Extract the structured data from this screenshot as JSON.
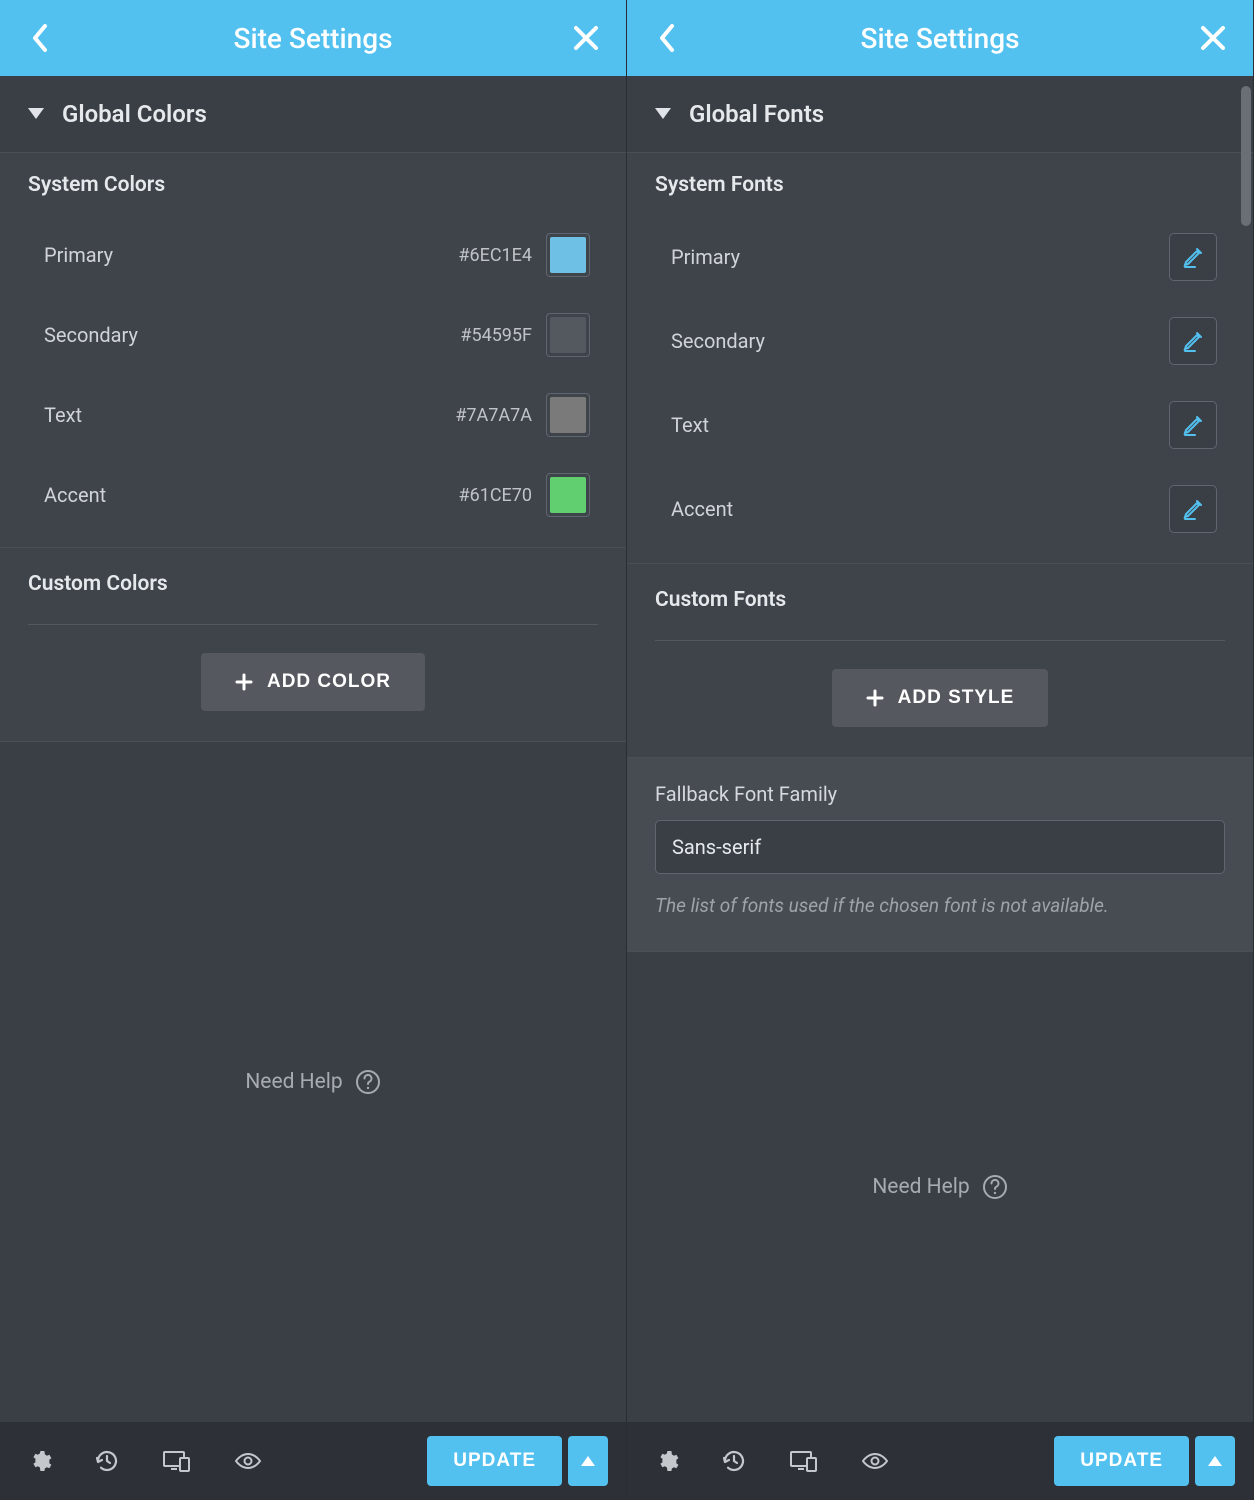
{
  "left": {
    "header": {
      "title": "Site Settings"
    },
    "section_title": "Global Colors",
    "system_title": "System Colors",
    "colors": [
      {
        "label": "Primary",
        "hex": "#6EC1E4",
        "value": "#6EC1E4"
      },
      {
        "label": "Secondary",
        "hex": "#54595F",
        "value": "#54595F"
      },
      {
        "label": "Text",
        "hex": "#7A7A7A",
        "value": "#7A7A7A"
      },
      {
        "label": "Accent",
        "hex": "#61CE70",
        "value": "#61CE70"
      }
    ],
    "custom_title": "Custom Colors",
    "add_label": "ADD COLOR",
    "need_help": "Need Help",
    "update_label": "UPDATE"
  },
  "right": {
    "header": {
      "title": "Site Settings"
    },
    "section_title": "Global Fonts",
    "system_title": "System Fonts",
    "fonts": [
      {
        "label": "Primary"
      },
      {
        "label": "Secondary"
      },
      {
        "label": "Text"
      },
      {
        "label": "Accent"
      }
    ],
    "custom_title": "Custom Fonts",
    "add_label": "ADD STYLE",
    "fallback": {
      "label": "Fallback Font Family",
      "value": "Sans-serif",
      "hint": "The list of fonts used if the chosen font is not available."
    },
    "need_help": "Need Help",
    "update_label": "UPDATE"
  }
}
